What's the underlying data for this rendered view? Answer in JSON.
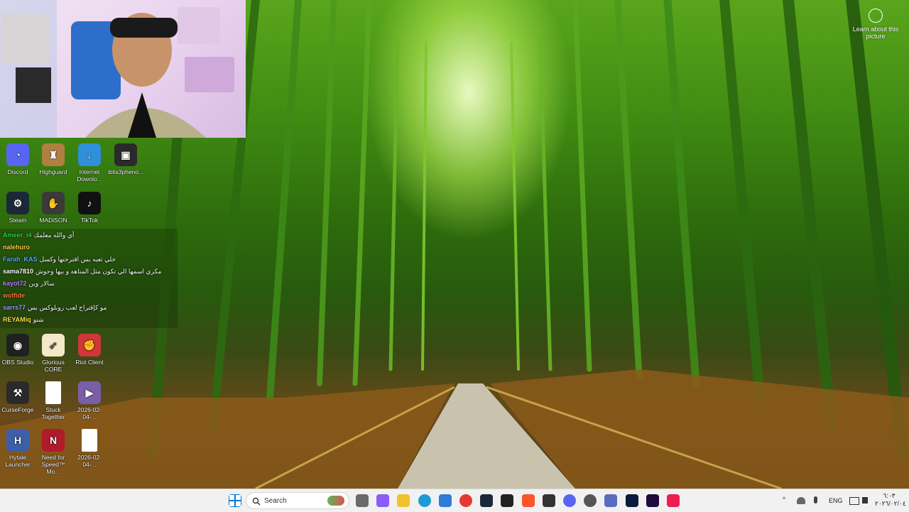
{
  "learn": {
    "text": "Learn about this picture",
    "icon": "camera-icon"
  },
  "desktop": {
    "icons": [
      {
        "label": "Discord",
        "icon": "discord-icon",
        "color": "#5865f2",
        "glyph": "◔"
      },
      {
        "label": "Highguard",
        "icon": "highguard-icon",
        "color": "#b08040",
        "glyph": "♜"
      },
      {
        "label": "Internet Downlo...",
        "icon": "idm-icon",
        "color": "#2f8fd8",
        "glyph": "↓"
      },
      {
        "label": "iblis3pheno...",
        "icon": "iblis-icon",
        "color": "#2a2a2a",
        "glyph": "▣"
      },
      {
        "label": "Steam",
        "icon": "steam-icon",
        "color": "#1b2838",
        "glyph": "⚙"
      },
      {
        "label": "MADiSON",
        "icon": "madison-icon",
        "color": "#3a3a3a",
        "glyph": "✋"
      },
      {
        "label": "TikTok",
        "icon": "tiktok-icon",
        "color": "#111111",
        "glyph": "♪"
      },
      {
        "label": "OBS Studio",
        "icon": "obs-icon",
        "color": "#202020",
        "glyph": "◉"
      },
      {
        "label": "Glorious CORE",
        "icon": "glorious-icon",
        "color": "#f3e9c8",
        "glyph": "➶"
      },
      {
        "label": "Riot Client",
        "icon": "riot-icon",
        "color": "#d13639",
        "glyph": "✊"
      },
      {
        "label": "CurseForge",
        "icon": "curseforge-icon",
        "color": "#2a2a2a",
        "glyph": "⚒"
      },
      {
        "label": "Stuck Together",
        "icon": "file-icon",
        "color": "#ffffff",
        "glyph": ""
      },
      {
        "label": "2026-02-04-...",
        "icon": "video-file-icon",
        "color": "#7b5ea8",
        "glyph": "▶"
      },
      {
        "label": "Hytale Launcher",
        "icon": "hytale-icon",
        "color": "#3b5fa8",
        "glyph": "H"
      },
      {
        "label": "Need for Speed™ Mo...",
        "icon": "nfs-icon",
        "color": "#b01a2a",
        "glyph": "N"
      },
      {
        "label": "2026-02-04-...",
        "icon": "file-icon",
        "color": "#ffffff",
        "glyph": ""
      }
    ]
  },
  "chat": {
    "messages": [
      {
        "user": "Ameer_i4",
        "text": "أي والله معلمك",
        "color": "#35d14a"
      },
      {
        "user": "nalehuro",
        "text": "",
        "color": "#ffd34a"
      },
      {
        "user": "Farah_KAS",
        "text": "خلي ثعبه بس اقترحتها وكسل",
        "color": "#4fb0ff"
      },
      {
        "user": "sama7810",
        "text": "مكري اسمها الي تكون مثل المتاهه و بيها وحوش",
        "color": "#ffffff"
      },
      {
        "user": "kayot72",
        "text": "سالار وين",
        "color": "#c27dff"
      },
      {
        "user": "wolfide",
        "text": "",
        "color": "#ff7a3d"
      },
      {
        "user": "sarrs77",
        "text": "مو كإقتراح لعب روبلوكس بس",
        "color": "#9aa6ff"
      },
      {
        "user": "REYAMiq",
        "text": "شنو",
        "color": "#ffe14a"
      }
    ]
  },
  "taskbar": {
    "search_label": "Search",
    "language": "ENG",
    "time": "٦:٠٣",
    "date": "٢٠٢٦/٠٢/٠٤",
    "apps": [
      {
        "icon": "task-view-icon",
        "color": "#6a6a6a"
      },
      {
        "icon": "copilot-icon",
        "color": "#8b5cf6"
      },
      {
        "icon": "file-explorer-icon",
        "color": "#f3c12b"
      },
      {
        "icon": "edge-icon",
        "color": "#1e9ad6"
      },
      {
        "icon": "store-icon",
        "color": "#2f7cd8"
      },
      {
        "icon": "chrome-icon",
        "color": "#e53935"
      },
      {
        "icon": "steam-icon",
        "color": "#1b2838"
      },
      {
        "icon": "obs-icon",
        "color": "#222222"
      },
      {
        "icon": "brave-icon",
        "color": "#fb542b"
      },
      {
        "icon": "curseforge-icon",
        "color": "#333333"
      },
      {
        "icon": "discord-icon",
        "color": "#5865f2"
      },
      {
        "icon": "gear-icon",
        "color": "#555555"
      },
      {
        "icon": "media-icon",
        "color": "#5c6bc0"
      },
      {
        "icon": "photoshop-icon",
        "color": "#0a1a3a"
      },
      {
        "icon": "premiere-icon",
        "color": "#1d0a3a"
      },
      {
        "icon": "tiktok-icon",
        "color": "#ee1d52"
      }
    ]
  }
}
